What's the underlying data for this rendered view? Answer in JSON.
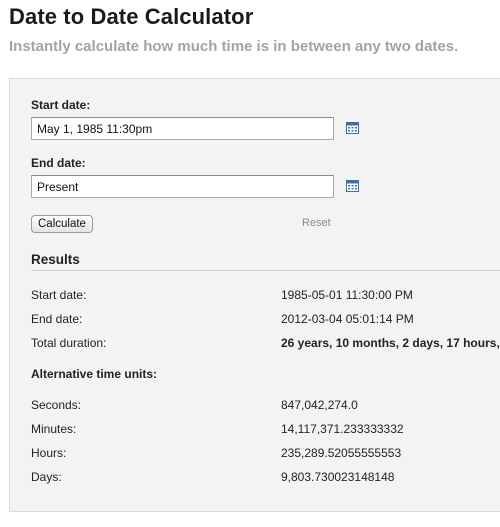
{
  "header": {
    "title": "Date to Date Calculator",
    "subtitle": "Instantly calculate how much time is in between any two dates."
  },
  "form": {
    "start_label": "Start date:",
    "start_value": "May 1, 1985 11:30pm",
    "end_label": "End date:",
    "end_value": "Present",
    "calendar_icon": "calendar-icon",
    "calculate_label": "Calculate",
    "reset_label": "Reset"
  },
  "results": {
    "heading": "Results",
    "rows": [
      {
        "label": "Start date:",
        "value": "1985-05-01 11:30:00 PM"
      },
      {
        "label": "End date:",
        "value": "2012-03-04 05:01:14 PM"
      },
      {
        "label": "Total duration:",
        "value": "26 years, 10 months, 2 days, 17 hours,"
      }
    ],
    "alt_heading": "Alternative time units:",
    "alt_rows": [
      {
        "label": "Seconds:",
        "value": "847,042,274.0"
      },
      {
        "label": "Minutes:",
        "value": "14,117,371.233333332"
      },
      {
        "label": "Hours:",
        "value": "235,289.52055555553"
      },
      {
        "label": "Days:",
        "value": "9,803.730023148148"
      }
    ]
  },
  "colors": {
    "panel_background": "#f3f3f3",
    "subtitle": "#a3a3a3",
    "reset_link": "#8a8a8a",
    "calendar_icon": "#3f6fa8"
  }
}
